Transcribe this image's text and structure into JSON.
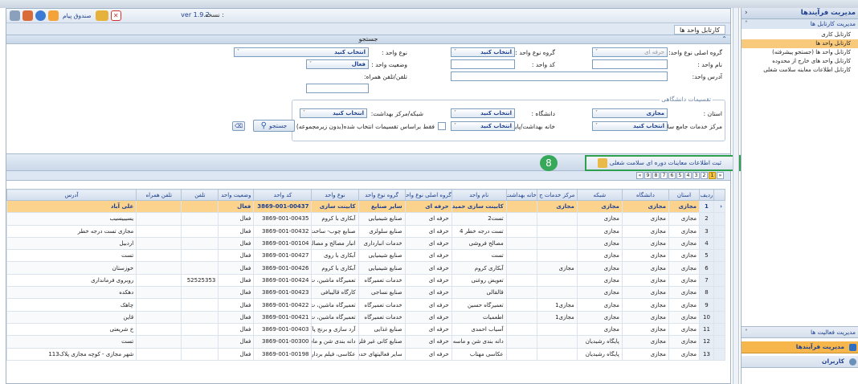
{
  "header": {
    "version_label": "نسخه :",
    "version": "ver 1.9.2",
    "mailbox": "صندوق پیام"
  },
  "tab_title": "کارتابل واحد ها",
  "search_bar": "جستجو",
  "form": {
    "main_group_label": "گروه اصلی نوع واحد:",
    "main_group_value": "حرفه ای",
    "unit_type_group_label": "گروه نوع واحد :",
    "unit_type_group_value": "انتخاب کنید",
    "unit_type_label": "نوع واحد :",
    "unit_type_value": "انتخاب کنید",
    "unit_name_label": "نام واحد :",
    "unit_code_label": "کد واحد :",
    "unit_status_label": "وضعیت واحد :",
    "unit_status_value": "فعال",
    "address_label": "آدرس واحد:",
    "phone_label": "تلفن/تلفن همراه:",
    "divisions_legend": "تقسیمات دانشگاهی",
    "province_label": "استان :",
    "province_value": "مجازی",
    "university_label": "دانشگاه :",
    "university_value": "انتخاب کنید",
    "network_label": "شبکه/مرکز بهداشت:",
    "network_value": "انتخاب کنید",
    "center_label": "مرکز خدمات جامع سلامت:",
    "center_value": "انتخاب کنید",
    "house_label": "خانه بهداشت/پایگاه:",
    "house_value": "انتخاب کنید",
    "only_selected_label": "فقط براساس تقسیمات انتخاب شده(بدون زیرمجموعه)",
    "search_button": "جستجو"
  },
  "toolbar": {
    "record_button": "ثبت اطلاعات معاینات دوره ای سلامت شغلی",
    "badge": "8"
  },
  "pager": {
    "pages": [
      "1",
      "2",
      "3",
      "4",
      "5",
      "6",
      "7",
      "8",
      "9"
    ],
    "active": "1"
  },
  "table": {
    "headers": [
      "ردیف",
      "استان",
      "دانشگاه",
      "شبکه",
      "مرکز خدمات ج",
      "خانه بهداشت",
      "نام واحد",
      "گروه اصلی نوع واحد",
      "گروه نوع واحد",
      "نوع واحد",
      "کد واحد",
      "وضعیت واحد",
      "تلفن",
      "تلفن همراه",
      "آدرس"
    ],
    "rows": [
      [
        "1",
        "مجازی",
        "مجازی",
        "مجازی",
        "مجازی",
        "",
        "کابینت سازی حمید",
        "حرفه ای",
        "سایر صنایع",
        "کابینت سازی",
        "3869-001-00437",
        "فعال",
        "",
        "",
        "علی آباد"
      ],
      [
        "2",
        "مجازی",
        "مجازی",
        "مجازی",
        "",
        "",
        "تست2",
        "حرفه ای",
        "صنایع شیمیایی",
        "آبکاری با کروم",
        "3869-001-00435",
        "فعال",
        "",
        "",
        "یسیبیسیب"
      ],
      [
        "3",
        "مجازی",
        "مجازی",
        "مجازی",
        "",
        "",
        "تست درجه خطر 4",
        "حرفه ای",
        "صنایع سلولزی",
        "صنایع چوب- ساخت",
        "3869-001-00432",
        "فعال",
        "",
        "",
        "مجازی تست درجه خطر"
      ],
      [
        "4",
        "مجازی",
        "مجازی",
        "مجازی",
        "",
        "",
        "مصالح فروشی",
        "حرفه ای",
        "خدمات انبارداری",
        "انبار مصالح و مصالح",
        "3869-001-00104",
        "فعال",
        "",
        "",
        "اردبیل"
      ],
      [
        "5",
        "مجازی",
        "مجازی",
        "مجازی",
        "",
        "",
        "تست",
        "حرفه ای",
        "صنایع شیمیایی",
        "آبکاری با روی",
        "3869-001-00427",
        "فعال",
        "",
        "",
        "تست"
      ],
      [
        "6",
        "مجازی",
        "مجازی",
        "مجازی",
        "مجازی",
        "",
        "آبکاری کروم",
        "حرفه ای",
        "صنایع شیمیایی",
        "آبکاری با کروم",
        "3869-001-00426",
        "فعال",
        "",
        "",
        "خوزستان"
      ],
      [
        "7",
        "مجازی",
        "مجازی",
        "مجازی",
        "",
        "",
        "تعویض روغنی",
        "حرفه ای",
        "خدمات تعمیرگاه",
        "تعمیرگاه ماشین، ت",
        "3869-001-00424",
        "فعال",
        "52525353",
        "",
        "روبروی فرمانداری"
      ],
      [
        "8",
        "مجازی",
        "مجازی",
        "مجازی",
        "",
        "",
        "قالقالی",
        "حرفه ای",
        "صنایع نساجی",
        "کارگاه قالیبافی",
        "3869-001-00423",
        "فعال",
        "",
        "",
        "دهکده"
      ],
      [
        "9",
        "مجازی",
        "مجازی",
        "مجازی",
        "مجازی1",
        "",
        "تعمیرگاه حسین",
        "حرفه ای",
        "خدمات تعمیرگاه",
        "تعمیرگاه ماشین، ت",
        "3869-001-00422",
        "فعال",
        "",
        "",
        "چاهک"
      ],
      [
        "10",
        "مجازی",
        "مجازی",
        "مجازی",
        "مجازی1",
        "",
        "اطعمیات",
        "حرفه ای",
        "خدمات تعمیرگاه",
        "تعمیرگاه ماشین، ت",
        "3869-001-00421",
        "فعال",
        "",
        "",
        "قاین"
      ],
      [
        "11",
        "مجازی",
        "مجازی",
        "مجازی",
        "",
        "",
        "آسیاب احمدی",
        "حرفه ای",
        "صنایع غذایی",
        "آرد سازی و برنج پاک",
        "3869-001-00403",
        "فعال",
        "",
        "",
        "خ شریعتی"
      ],
      [
        "12",
        "مجازی",
        "مجازی",
        "پایگاه رشیدیان",
        "",
        "",
        "دانه بندی شن و ماسه",
        "حرفه ای",
        "صنایع کانی غیر فلزی",
        "دانه بندی شن و ماسه",
        "3869-001-00300",
        "فعال",
        "",
        "",
        "تست"
      ],
      [
        "13",
        "مجازی",
        "مجازی",
        "پایگاه رشیدیان",
        "",
        "",
        "عکاسی مهتاب",
        "حرفه ای",
        "سایر فعالیتهای خدماتی",
        "عکاسی، فیلم برداری",
        "3869-001-00198",
        "فعال",
        "",
        "",
        "شهر مجازی - کوچه مجازی پلاک113"
      ]
    ]
  },
  "sidebar": {
    "title": "مدیریت فرآیندها",
    "subtitle": "مدیریت کارتابل ها",
    "items": [
      "کارتابل کاری",
      "کارتابل واحد ها",
      "کارتابل واحد ها (جستجو پیشرفته)",
      "کارتابل واحد های خارج از محدوده",
      "کارتابل اطلاعات معاینه سلامت شغلی"
    ],
    "activities": "مدیریت فعالیت ها",
    "processes": "مدیریت فرآیندها",
    "users": "کاربران"
  }
}
